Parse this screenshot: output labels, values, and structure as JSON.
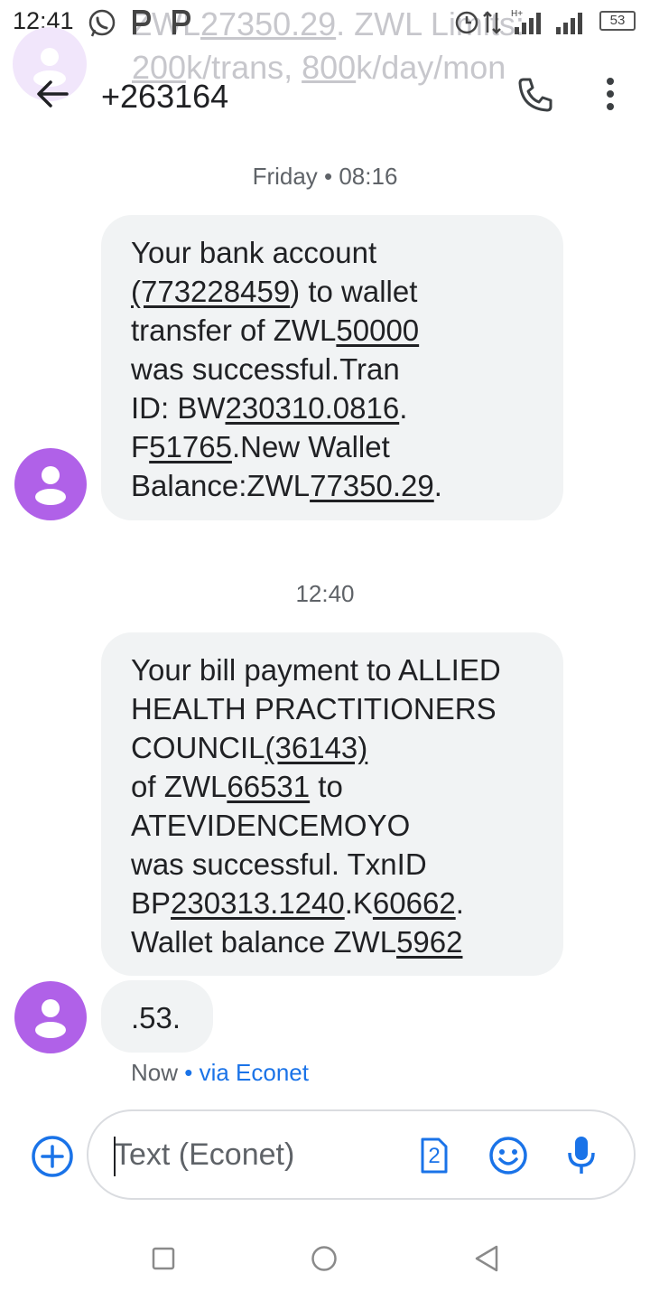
{
  "status_bar": {
    "time": "12:41",
    "battery": "53",
    "ghost_notification": {
      "line1_prefix": "ZWL",
      "line1_underlined": "27350.29",
      "line1_suffix": ". ZWL Limits:",
      "line2_underlined_1": "200",
      "line2_mid": "k/trans, ",
      "line2_underlined_2": "800",
      "line2_suffix": "k/day/mon"
    }
  },
  "app_bar": {
    "title": "+263164",
    "back_icon": "arrow-left-icon",
    "call_icon": "phone-icon",
    "more_icon": "more-vert-icon"
  },
  "conversation": {
    "separator_1": "Friday • 08:16",
    "message_1": {
      "l1": "Your bank account",
      "l2_u": "(773228459",
      "l2_t": ") to wallet",
      "l3_t": "transfer of ZWL",
      "l3_u": "50000",
      "l4": "was successful.Tran",
      "l5_t1": "ID: BW",
      "l5_u": "230310.0816",
      "l5_t2": ".",
      "l6_t1": "F",
      "l6_u": "51765",
      "l6_t2": ".New Wallet",
      "l7_t1": "Balance:ZWL",
      "l7_u": "77350.29",
      "l7_t2": "."
    },
    "separator_2": "12:40",
    "message_2": {
      "l1": "Your bill payment to ALLIED",
      "l2": "HEALTH PRACTITIONERS",
      "l3_t": "COUNCIL",
      "l3_u": "(36143)",
      "l4_t1": "of ZWL",
      "l4_u": "66531",
      "l4_t2": " to",
      "l5": "ATEVIDENCEMOYO",
      "l6": "was successful. TxnID",
      "l7_t1": "BP",
      "l7_u1": "230313.1240",
      "l7_t2": ".K",
      "l7_u2": "60662",
      "l7_t3": ".",
      "l8_t": "Wallet balance ZWL",
      "l8_u": "5962"
    },
    "message_3": ".53.",
    "meta_time": "Now",
    "meta_dot": " • ",
    "meta_via": "via Econet"
  },
  "compose": {
    "placeholder": "Text (Econet)",
    "sim_label": "2",
    "add_icon": "add-circle-icon",
    "emoji_icon": "emoji-icon",
    "mic_icon": "microphone-icon"
  },
  "colors": {
    "accent": "#1a73e8",
    "avatar": "#b061e8",
    "bubble": "#f1f3f4"
  }
}
